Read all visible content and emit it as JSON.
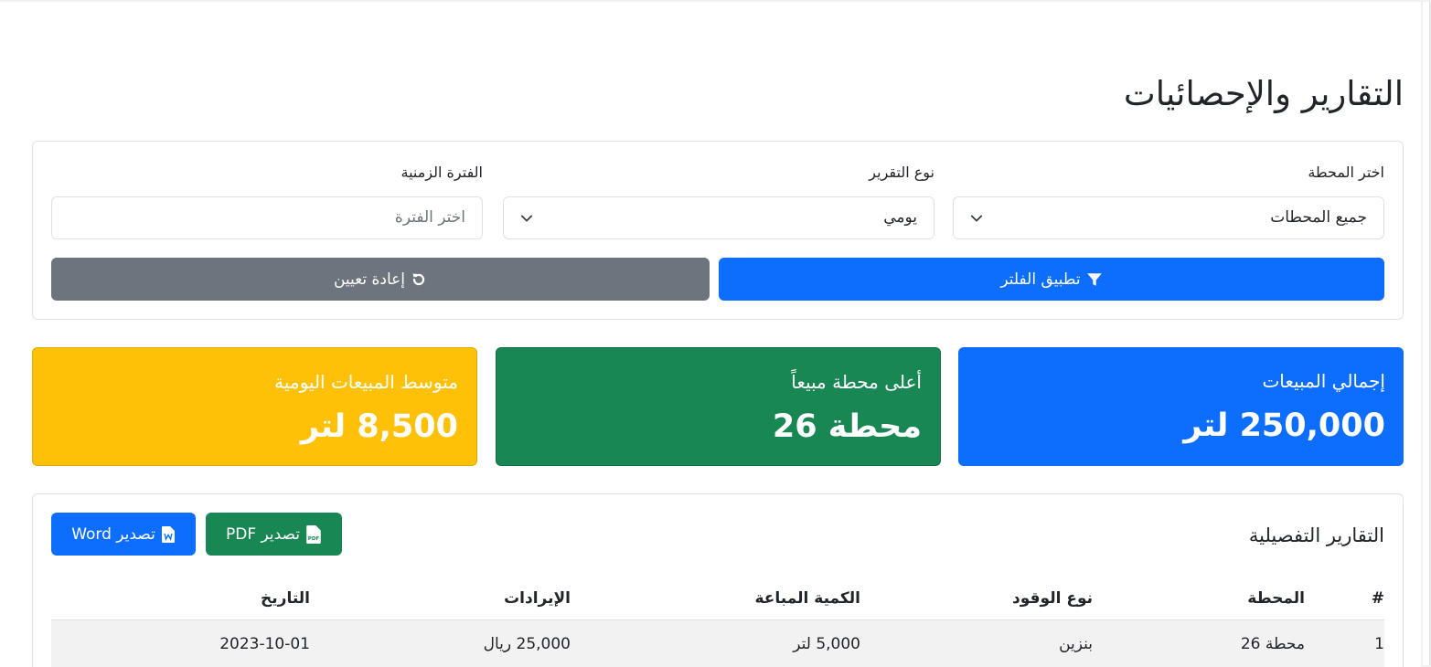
{
  "page": {
    "title": "التقارير والإحصائيات"
  },
  "filters": {
    "station": {
      "label": "اختر المحطة",
      "value": "جميع المحطات"
    },
    "report_type": {
      "label": "نوع التقرير",
      "value": "يومي"
    },
    "period": {
      "label": "الفترة الزمنية",
      "placeholder": "اختر الفترة"
    },
    "apply_label": "تطبيق الفلتر",
    "reset_label": "إعادة تعيين"
  },
  "stats": [
    {
      "title": "إجمالي المبيعات",
      "value": "250,000 لتر",
      "color": "#0d6efd"
    },
    {
      "title": "أعلى محطة مبيعاً",
      "value": "محطة 26",
      "color": "#198754"
    },
    {
      "title": "متوسط المبيعات اليومية",
      "value": "8,500 لتر",
      "color": "#ffc107"
    }
  ],
  "reports": {
    "title": "التقارير التفصيلية",
    "export_pdf": "تصدير PDF",
    "export_word": "تصدير Word",
    "columns": [
      "#",
      "المحطة",
      "نوع الوقود",
      "الكمية المباعة",
      "الإيرادات",
      "التاريخ"
    ],
    "rows": [
      [
        "1",
        "محطة 26",
        "بنزين",
        "5,000 لتر",
        "25,000 ريال",
        "2023-10-01"
      ]
    ]
  },
  "icons": {
    "filter": "filter-icon",
    "reset": "rotate-left-icon",
    "pdf": "file-pdf-icon",
    "word": "file-word-icon",
    "chevron": "chevron-down-icon"
  }
}
